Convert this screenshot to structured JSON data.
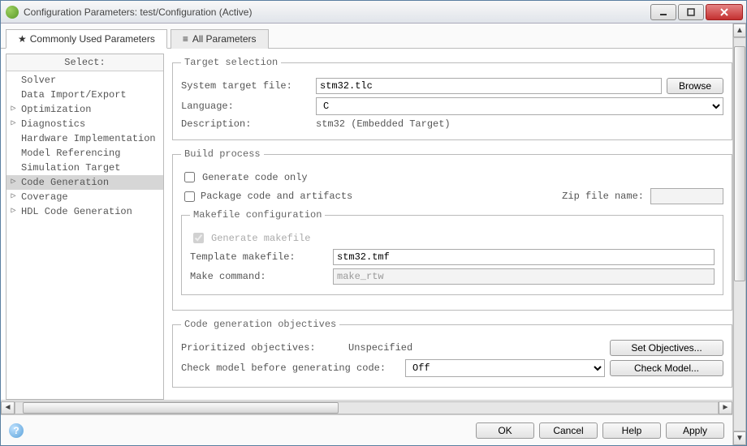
{
  "window": {
    "title": "Configuration Parameters: test/Configuration (Active)"
  },
  "tabs": {
    "common": "Commonly Used Parameters",
    "all": "All Parameters"
  },
  "sidebar": {
    "header": "Select:",
    "items": [
      {
        "label": "Solver",
        "expandable": false
      },
      {
        "label": "Data Import/Export",
        "expandable": false
      },
      {
        "label": "Optimization",
        "expandable": true
      },
      {
        "label": "Diagnostics",
        "expandable": true
      },
      {
        "label": "Hardware Implementation",
        "expandable": false
      },
      {
        "label": "Model Referencing",
        "expandable": false
      },
      {
        "label": "Simulation Target",
        "expandable": false
      },
      {
        "label": "Code Generation",
        "expandable": true,
        "selected": true
      },
      {
        "label": "Coverage",
        "expandable": true
      },
      {
        "label": "HDL Code Generation",
        "expandable": true
      }
    ]
  },
  "target_selection": {
    "legend": "Target selection",
    "system_target_file_label": "System target file:",
    "system_target_file_value": "stm32.tlc",
    "browse_label": "Browse",
    "language_label": "Language:",
    "language_value": "C",
    "description_label": "Description:",
    "description_value": "stm32 (Embedded Target)"
  },
  "build_process": {
    "legend": "Build process",
    "generate_code_only_label": "Generate code only",
    "generate_code_only_checked": false,
    "package_code_label": "Package code and artifacts",
    "package_code_checked": false,
    "zip_file_label": "Zip file name:",
    "zip_file_value": "",
    "makefile": {
      "legend": "Makefile configuration",
      "generate_makefile_label": "Generate makefile",
      "generate_makefile_checked": true,
      "generate_makefile_disabled": true,
      "template_label": "Template makefile:",
      "template_value": "stm32.tmf",
      "make_cmd_label": "Make command:",
      "make_cmd_value": "make_rtw"
    }
  },
  "objectives": {
    "legend": "Code generation objectives",
    "prioritized_label": "Prioritized objectives:",
    "prioritized_value": "Unspecified",
    "set_button": "Set Objectives...",
    "check_label": "Check model before generating code:",
    "check_value": "Off",
    "check_button": "Check Model..."
  },
  "footer": {
    "ok": "OK",
    "cancel": "Cancel",
    "help": "Help",
    "apply": "Apply"
  }
}
